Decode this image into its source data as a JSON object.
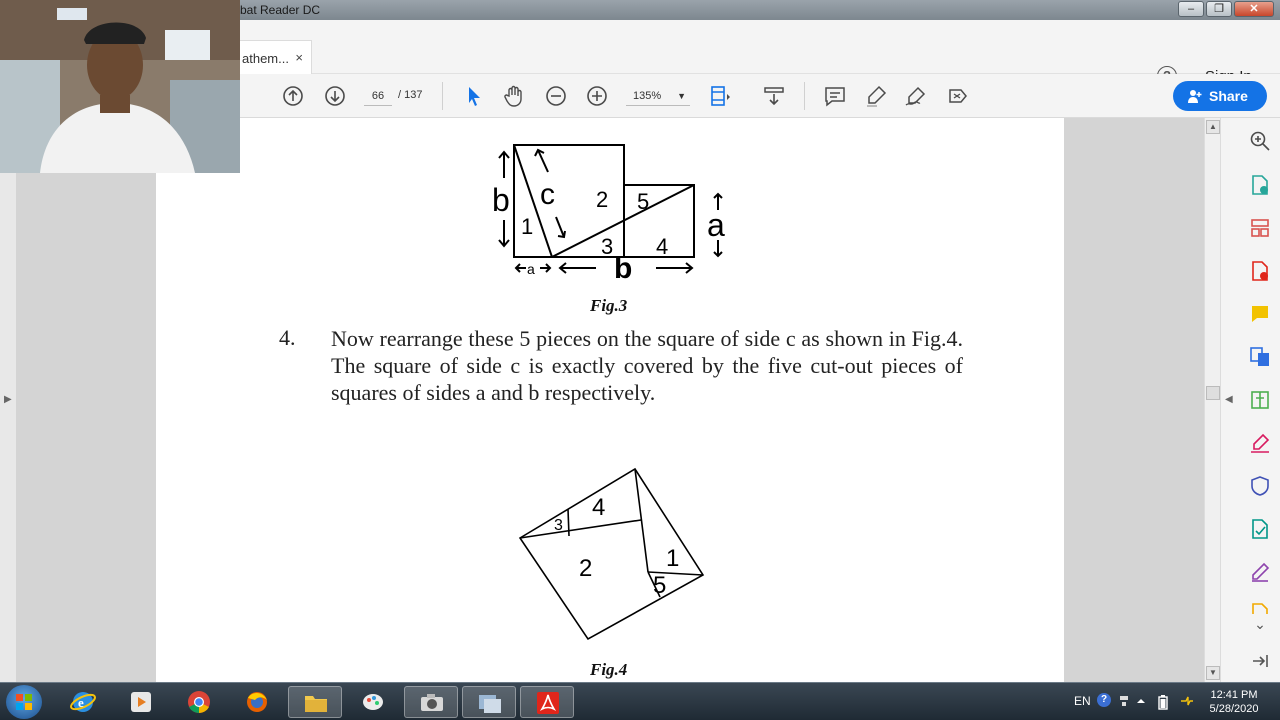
{
  "window": {
    "title": "bat Reader DC",
    "buttons": [
      "–",
      "❐",
      "✕"
    ]
  },
  "tabs": {
    "doc_tab_label": "athem...",
    "close_glyph": "×",
    "help_glyph": "?",
    "sign_in": "Sign In"
  },
  "toolbar": {
    "current_page": "66",
    "total_pages": "/ 137",
    "zoom": "135%",
    "share_label": "Share",
    "icons": [
      "previous-page-icon",
      "next-page-icon",
      "select-arrow-icon",
      "hand-tool-icon",
      "zoom-out-icon",
      "zoom-in-icon",
      "fit-page-icon",
      "scroll-mode-icon",
      "comment-icon",
      "highlight-icon",
      "sign-icon",
      "more-tools-icon"
    ]
  },
  "document": {
    "fig3": {
      "label_b": "b",
      "label_c": "c",
      "label_a_right": "a",
      "label_a_small": "a",
      "label_b_bottom": "b",
      "pieces": [
        "1",
        "2",
        "3",
        "4",
        "5"
      ],
      "caption": "Fig.3"
    },
    "item_number": "4.",
    "paragraph": "Now rearrange these 5  pieces on the square of side c as shown in Fig.4. The square of side c is exactly covered by the five cut-out pieces of squares of sides a and b respectively.",
    "fig4": {
      "pieces": [
        "1",
        "2",
        "3",
        "4",
        "5"
      ],
      "caption": "Fig.4"
    }
  },
  "right_pane": {
    "icons": [
      "search-zoom-icon",
      "export-pdf-icon",
      "organize-pages-icon",
      "create-pdf-icon",
      "comment-tool-icon",
      "combine-files-icon",
      "compress-icon",
      "fill-sign-icon",
      "protect-icon",
      "send-review-icon",
      "edit-pdf-icon",
      "more-icon"
    ]
  },
  "taskbar": {
    "language": "EN",
    "help": "?",
    "time": "12:41 PM",
    "date": "5/28/2020",
    "apps": [
      "internet-explorer",
      "media-player",
      "chrome",
      "firefox",
      "file-explorer",
      "paint",
      "camera",
      "screen-recorder",
      "acrobat"
    ]
  },
  "colors": {
    "accent": "#1473e6",
    "toolbar_bg": "#f4f4f4",
    "doc_bg": "#d4d4d4",
    "taskbar": "#26323d",
    "acrobat_red": "#e0261b"
  }
}
